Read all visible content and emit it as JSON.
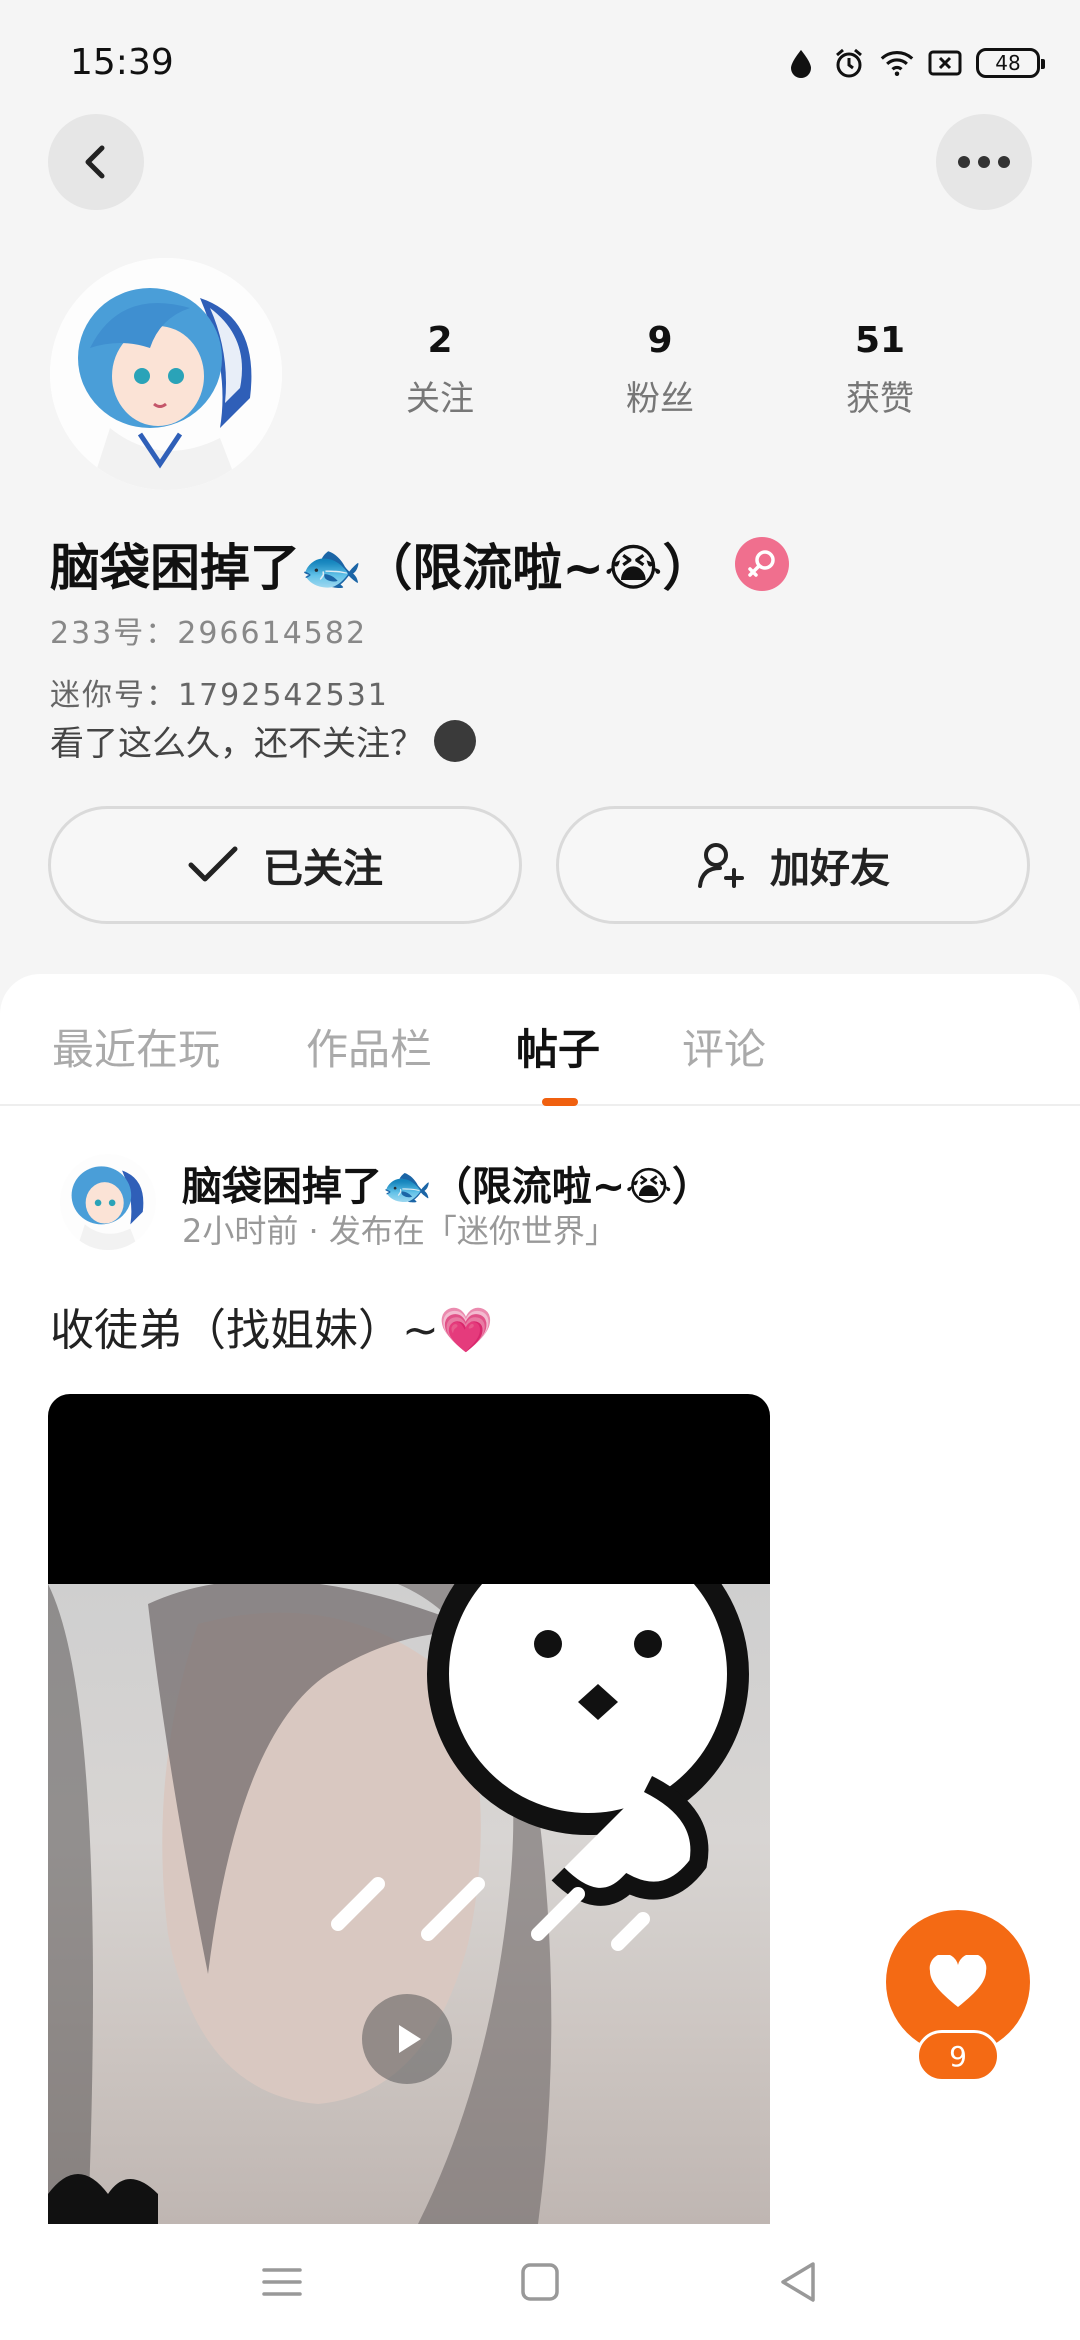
{
  "status_bar": {
    "time": "15:39",
    "battery": "48",
    "icons": [
      "data-drop-icon",
      "alarm-icon",
      "wifi-icon",
      "no-sim-icon",
      "battery-icon"
    ]
  },
  "header": {
    "back_icon": "chevron-left-icon",
    "more_icon": "more-horizontal-icon"
  },
  "profile": {
    "stats": [
      {
        "value": "2",
        "label": "关注"
      },
      {
        "value": "9",
        "label": "粉丝"
      },
      {
        "value": "51",
        "label": "获赞"
      }
    ],
    "username": "脑袋困掉了🐟（限流啦~😭）",
    "gender": "female",
    "id_233": "233号：296614582",
    "id_mini": "迷你号：1792542531",
    "bio": "看了这么久，还不关注？",
    "follow_button": "已关注",
    "add_friend_button": "加好友"
  },
  "tabs": [
    "最近在玩",
    "作品栏",
    "帖子",
    "评论"
  ],
  "active_tab": "帖子",
  "post": {
    "author": "脑袋困掉了🐟（限流啦~😭）",
    "meta": "2小时前 · 发布在「迷你世界」",
    "title": "收徒弟（找姐妹）~💗",
    "media_type": "video"
  },
  "like": {
    "count": "9"
  },
  "colors": {
    "accent": "#f46a14",
    "tab_indicator": "#f0600f",
    "gender_badge": "#f06f8e"
  }
}
